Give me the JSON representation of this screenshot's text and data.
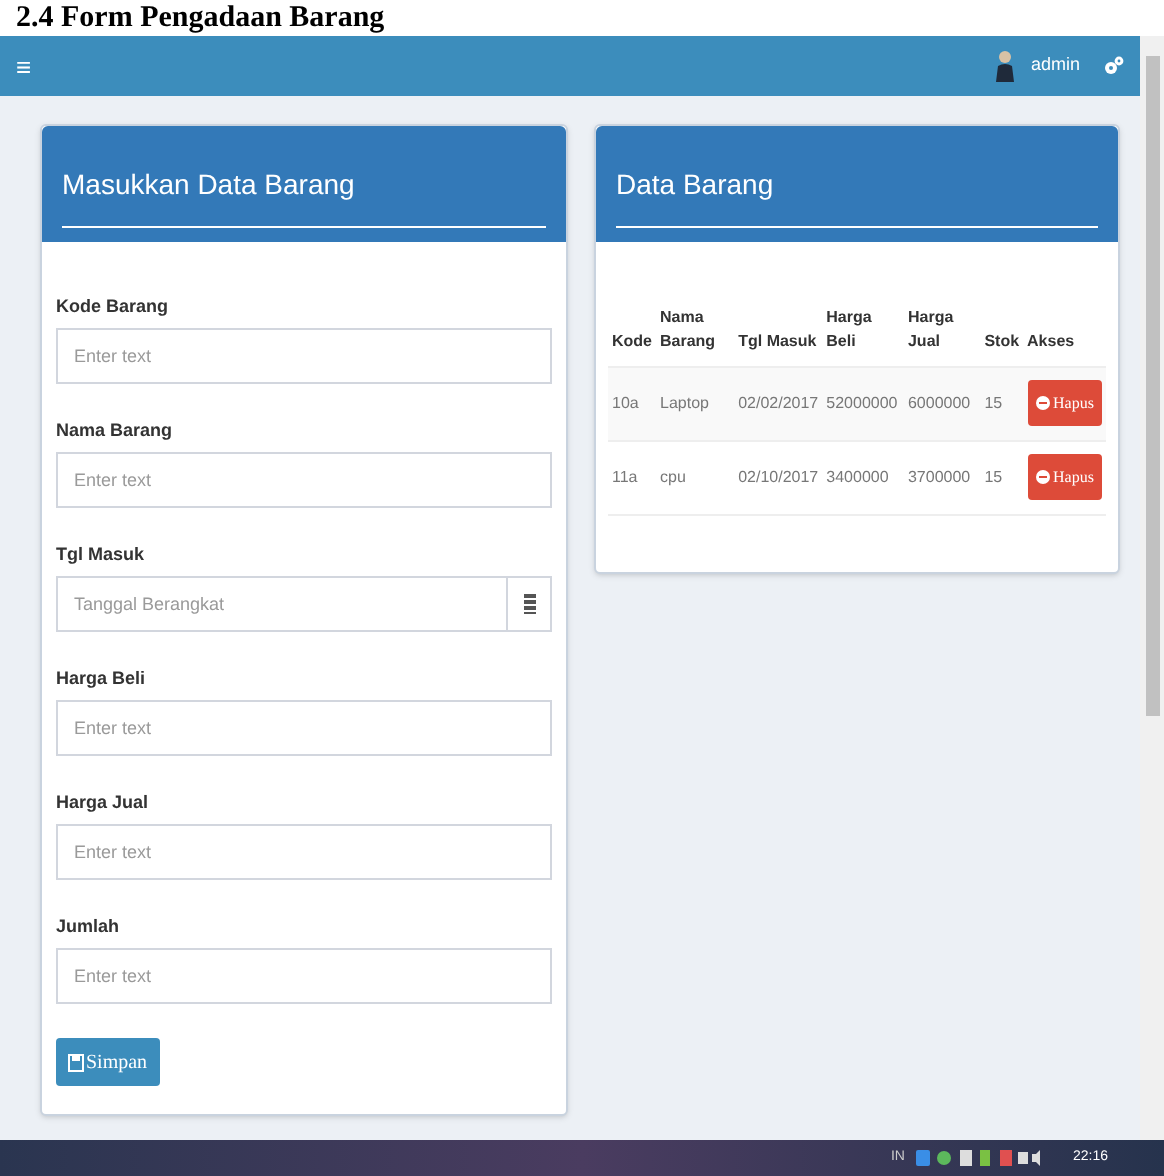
{
  "document_heading": "2.4 Form Pengadaan Barang",
  "navbar": {
    "menu_glyph": "≡",
    "user": "admin"
  },
  "form_panel": {
    "title": "Masukkan Data Barang",
    "fields": [
      {
        "label": "Kode Barang",
        "placeholder": "Enter text",
        "kind": "text"
      },
      {
        "label": "Nama Barang",
        "placeholder": "Enter text",
        "kind": "text"
      },
      {
        "label": "Tgl Masuk",
        "placeholder": "Tanggal Berangkat",
        "kind": "date"
      },
      {
        "label": "Harga Beli",
        "placeholder": "Enter text",
        "kind": "text"
      },
      {
        "label": "Harga Jual",
        "placeholder": "Enter text",
        "kind": "text"
      },
      {
        "label": "Jumlah",
        "placeholder": "Enter text",
        "kind": "text"
      }
    ],
    "submit": "Simpan"
  },
  "table_panel": {
    "title": "Data Barang",
    "columns": [
      "Kode",
      "Nama Barang",
      "Tgl Masuk",
      "Harga Beli",
      "Harga Jual",
      "Stok",
      "Akses"
    ],
    "rows": [
      {
        "cells": [
          "10a",
          "Laptop",
          "02/02/2017",
          "52000000",
          "6000000",
          "15"
        ],
        "action": "Hapus"
      },
      {
        "cells": [
          "11a",
          "cpu",
          "02/10/2017",
          "3400000",
          "3700000",
          "15"
        ],
        "action": "Hapus"
      }
    ]
  },
  "taskbar": {
    "language": "IN",
    "time": "22:16"
  }
}
